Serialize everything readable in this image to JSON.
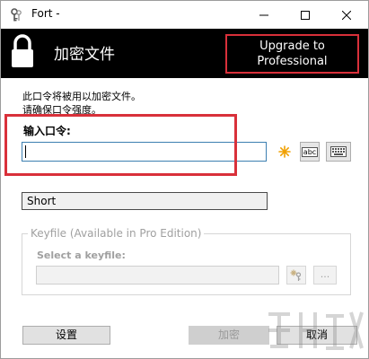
{
  "window": {
    "title": "Fort -"
  },
  "header": {
    "title": "加密文件",
    "upgrade_label": "Upgrade to\nProfessional"
  },
  "description": {
    "line1": "此口令将被用以加密文件。",
    "line2": "请确保口令强度。"
  },
  "password": {
    "label": "输入口令:",
    "value": "",
    "abc_label": "abc"
  },
  "strength": {
    "value": "Short"
  },
  "keyfile": {
    "legend": "Keyfile (Available in Pro Edition)",
    "label": "Select a keyfile:",
    "value": "",
    "more_label": "..."
  },
  "buttons": {
    "settings": "设置",
    "encrypt": "加密",
    "cancel": "取消"
  },
  "colors": {
    "header_bg": "#000000",
    "highlight": "#d9303a",
    "input_border": "#3c7fb1",
    "star": "#f0a000"
  }
}
